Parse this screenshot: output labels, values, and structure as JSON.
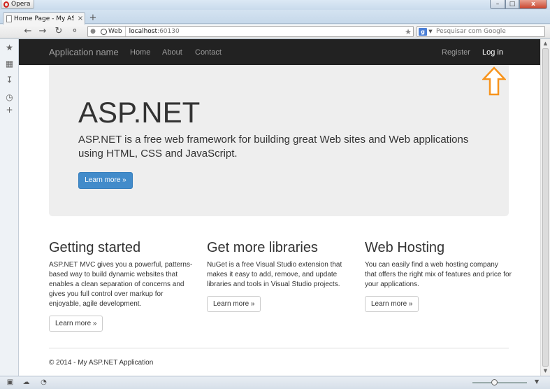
{
  "browser": {
    "menu_label": "Opera",
    "tab_title": "Home Page - My ASP....",
    "tab_close": "×",
    "new_tab": "+",
    "address_mode": "Web",
    "url_host": "localhost",
    "url_port": ":60130",
    "search_placeholder": "Pesquisar com Google",
    "window_controls": {
      "minimize": "–",
      "maximize": "□",
      "close": "x"
    }
  },
  "site": {
    "brand": "Application name",
    "nav": [
      {
        "label": "Home"
      },
      {
        "label": "About"
      },
      {
        "label": "Contact"
      }
    ],
    "nav_right": [
      {
        "label": "Register"
      },
      {
        "label": "Log in"
      }
    ],
    "jumbotron": {
      "title": "ASP.NET",
      "lead": "ASP.NET is a free web framework for building great Web sites and Web applications using HTML, CSS and JavaScript.",
      "button": "Learn more »"
    },
    "columns": [
      {
        "heading": "Getting started",
        "text": "ASP.NET MVC gives you a powerful, patterns-based way to build dynamic websites that enables a clean separation of concerns and gives you full control over markup for enjoyable, agile development.",
        "button": "Learn more »"
      },
      {
        "heading": "Get more libraries",
        "text": "NuGet is a free Visual Studio extension that makes it easy to add, remove, and update libraries and tools in Visual Studio projects.",
        "button": "Learn more »"
      },
      {
        "heading": "Web Hosting",
        "text": "You can easily find a web hosting company that offers the right mix of features and price for your applications.",
        "button": "Learn more »"
      }
    ],
    "footer": "© 2014 - My ASP.NET Application"
  },
  "annotation": {
    "arrow_color": "#f7941d",
    "points_to": "Log in"
  },
  "colors": {
    "navbar": "#222222",
    "primary_button": "#428bca",
    "jumbotron": "#eeeeee"
  }
}
